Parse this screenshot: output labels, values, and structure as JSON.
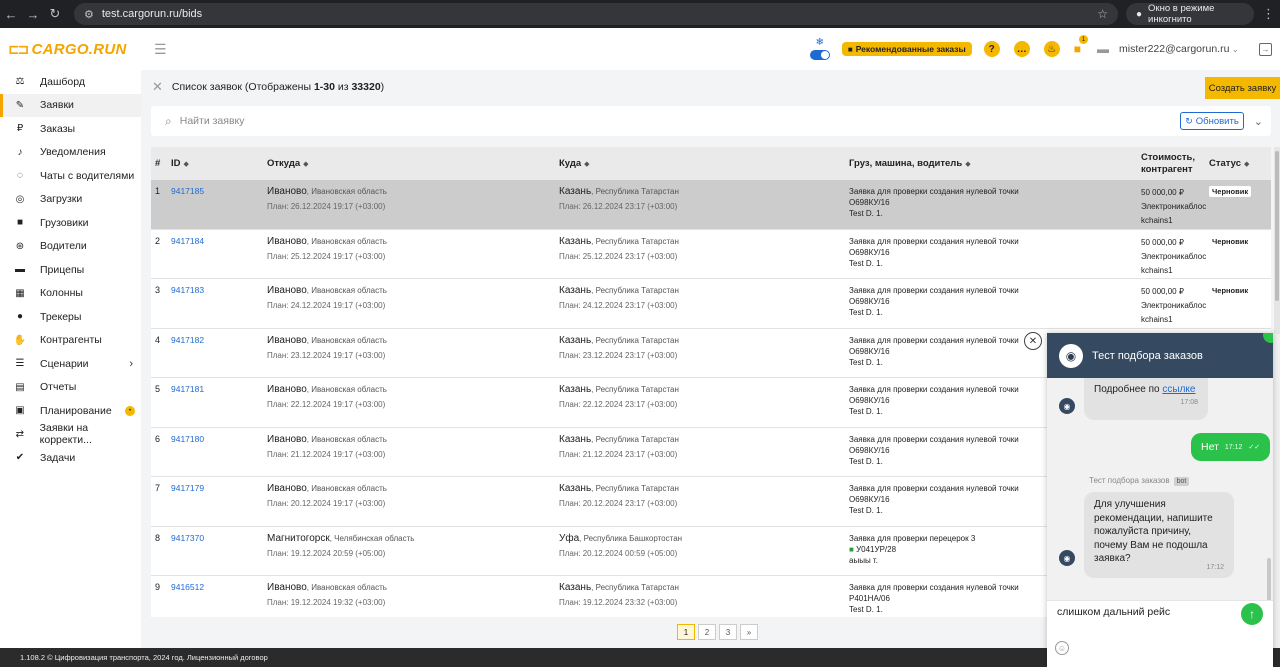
{
  "browser": {
    "url": "test.cargorun.ru/bids",
    "incognito_label": "Окно в режиме инкогнито"
  },
  "header": {
    "logo_text": "CARGO.RUN",
    "recommended_label": "Рекомендованные заказы",
    "help_glyph": "?",
    "bag_count": "1",
    "user_email": "mister222@cargorun.ru"
  },
  "sidebar": {
    "items": [
      {
        "label": "Дашборд",
        "icon": "scale-icon"
      },
      {
        "label": "Заявки",
        "icon": "edit-icon"
      },
      {
        "label": "Заказы",
        "icon": "ruble-icon"
      },
      {
        "label": "Уведомления",
        "icon": "bell-icon"
      },
      {
        "label": "Чаты с водителями",
        "icon": "chat-icon"
      },
      {
        "label": "Загрузки",
        "icon": "compass-icon"
      },
      {
        "label": "Грузовики",
        "icon": "truck-icon"
      },
      {
        "label": "Водители",
        "icon": "steering-wheel-icon"
      },
      {
        "label": "Прицепы",
        "icon": "trailer-icon"
      },
      {
        "label": "Колонны",
        "icon": "columns-icon"
      },
      {
        "label": "Трекеры",
        "icon": "pin-icon"
      },
      {
        "label": "Контрагенты",
        "icon": "handshake-icon"
      },
      {
        "label": "Сценарии",
        "icon": "list-icon"
      },
      {
        "label": "Отчеты",
        "icon": "clipboard-icon"
      },
      {
        "label": "Планирование",
        "icon": "calendar-icon"
      },
      {
        "label": "Заявки на корректи...",
        "icon": "route-icon"
      },
      {
        "label": "Задачи",
        "icon": "check-icon"
      }
    ]
  },
  "main": {
    "title_prefix": "Список заявок (Отображены ",
    "title_range": "1-30",
    "title_mid": " из ",
    "title_total": "33320",
    "title_suffix": ")",
    "create_label": "Создать заявку",
    "search_placeholder": "Найти заявку",
    "refresh_label": "Обновить",
    "columns": {
      "num": "#",
      "id": "ID",
      "from": "Откуда",
      "to": "Куда",
      "cargo": "Груз, машина, водитель",
      "cost": "Стоимость, контрагент",
      "status": "Статус"
    },
    "rows": [
      {
        "n": "1",
        "id": "9417185",
        "from_city": "Иваново",
        "from_region": ", Ивановская область",
        "from_plan": "План: 26.12.2024 19:17 (+03:00)",
        "to_city": "Казань",
        "to_region": ", Республика Татарстан",
        "to_plan": "План: 26.12.2024 23:17 (+03:00)",
        "cargo": "Заявка для проверки создания нулевой точки",
        "truck": "О698КУ/16",
        "driver": "Test D. 1.",
        "cost": "50 000,00 ₽",
        "contractor": "Электроникаблоckchains1",
        "status": "Черновик"
      },
      {
        "n": "2",
        "id": "9417184",
        "from_city": "Иваново",
        "from_region": ", Ивановская область",
        "from_plan": "План: 25.12.2024 19:17 (+03:00)",
        "to_city": "Казань",
        "to_region": ", Республика Татарстан",
        "to_plan": "План: 25.12.2024 23:17 (+03:00)",
        "cargo": "Заявка для проверки создания нулевой точки",
        "truck": "О698КУ/16",
        "driver": "Test D. 1.",
        "cost": "50 000,00 ₽",
        "contractor": "Электроникаблоckchains1",
        "status": "Черновик"
      },
      {
        "n": "3",
        "id": "9417183",
        "from_city": "Иваново",
        "from_region": ", Ивановская область",
        "from_plan": "План: 24.12.2024 19:17 (+03:00)",
        "to_city": "Казань",
        "to_region": ", Республика Татарстан",
        "to_plan": "План: 24.12.2024 23:17 (+03:00)",
        "cargo": "Заявка для проверки создания нулевой точки",
        "truck": "О698КУ/16",
        "driver": "Test D. 1.",
        "cost": "50 000,00 ₽",
        "contractor": "Электроникаблоckchains1",
        "status": "Черновик"
      },
      {
        "n": "4",
        "id": "9417182",
        "from_city": "Иваново",
        "from_region": ", Ивановская область",
        "from_plan": "План: 23.12.2024 19:17 (+03:00)",
        "to_city": "Казань",
        "to_region": ", Республика Татарстан",
        "to_plan": "План: 23.12.2024 23:17 (+03:00)",
        "cargo": "Заявка для проверки создания нулевой точки",
        "truck": "О698КУ/16",
        "driver": "Test D. 1.",
        "cost": "",
        "contractor": "",
        "status": ""
      },
      {
        "n": "5",
        "id": "9417181",
        "from_city": "Иваново",
        "from_region": ", Ивановская область",
        "from_plan": "План: 22.12.2024 19:17 (+03:00)",
        "to_city": "Казань",
        "to_region": ", Республика Татарстан",
        "to_plan": "План: 22.12.2024 23:17 (+03:00)",
        "cargo": "Заявка для проверки создания нулевой точки",
        "truck": "О698КУ/16",
        "driver": "Test D. 1.",
        "cost": "",
        "contractor": "",
        "status": ""
      },
      {
        "n": "6",
        "id": "9417180",
        "from_city": "Иваново",
        "from_region": ", Ивановская область",
        "from_plan": "План: 21.12.2024 19:17 (+03:00)",
        "to_city": "Казань",
        "to_region": ", Республика Татарстан",
        "to_plan": "План: 21.12.2024 23:17 (+03:00)",
        "cargo": "Заявка для проверки создания нулевой точки",
        "truck": "О698КУ/16",
        "driver": "Test D. 1.",
        "cost": "",
        "contractor": "",
        "status": ""
      },
      {
        "n": "7",
        "id": "9417179",
        "from_city": "Иваново",
        "from_region": ", Ивановская область",
        "from_plan": "План: 20.12.2024 19:17 (+03:00)",
        "to_city": "Казань",
        "to_region": ", Республика Татарстан",
        "to_plan": "План: 20.12.2024 23:17 (+03:00)",
        "cargo": "Заявка для проверки создания нулевой точки",
        "truck": "О698КУ/16",
        "driver": "Test D. 1.",
        "cost": "",
        "contractor": "",
        "status": ""
      },
      {
        "n": "8",
        "id": "9417370",
        "from_city": "Магнитогорск",
        "from_region": ", Челябинская область",
        "from_plan": "План: 19.12.2024 20:59 (+05:00)",
        "to_city": "Уфа",
        "to_region": ", Республика Башкортостан",
        "to_plan": "План: 20.12.2024 00:59 (+05:00)",
        "cargo": "Заявка для проверки перецерок 3",
        "truck": "У041УР/28",
        "driver": "аыыы т.",
        "cost": "",
        "contractor": "",
        "status": ""
      },
      {
        "n": "9",
        "id": "9416512",
        "from_city": "Иваново",
        "from_region": ", Ивановская область",
        "from_plan": "План: 19.12.2024 19:32 (+03:00)",
        "to_city": "Казань",
        "to_region": ", Республика Татарстан",
        "to_plan": "План: 19.12.2024 23:32 (+03:00)",
        "cargo": "Заявка для проверки создания нулевой точки",
        "truck": "Р401НА/06",
        "driver": "Test D. 1.",
        "cost": "",
        "contractor": "",
        "status": ""
      }
    ],
    "pages": [
      "1",
      "2",
      "3",
      "»"
    ]
  },
  "footer": {
    "text": "1.108.2 © Цифровизация транспорта, 2024 год.  Лицензионный договор"
  },
  "chat": {
    "title": "Тест подбора заказов",
    "msg1_prefix": "Подробнее по ",
    "msg1_link": "ссылке",
    "msg1_time": "17:08",
    "msg2_text": "Нет",
    "msg2_time": "17:12",
    "bot_name": "Тест подбора заказов",
    "bot_tag": "bot",
    "msg3_text": "Для улучшения рекомендации, напишите пожалуйста причину, почему Вам не подошла заявка?",
    "msg3_time": "17:12",
    "input_value": "слишком дальний рейс"
  },
  "colors": {
    "accent": "#f5b800",
    "link": "#1e6ad3",
    "chat_header": "#354a60",
    "chat_green": "#2ac24a"
  }
}
